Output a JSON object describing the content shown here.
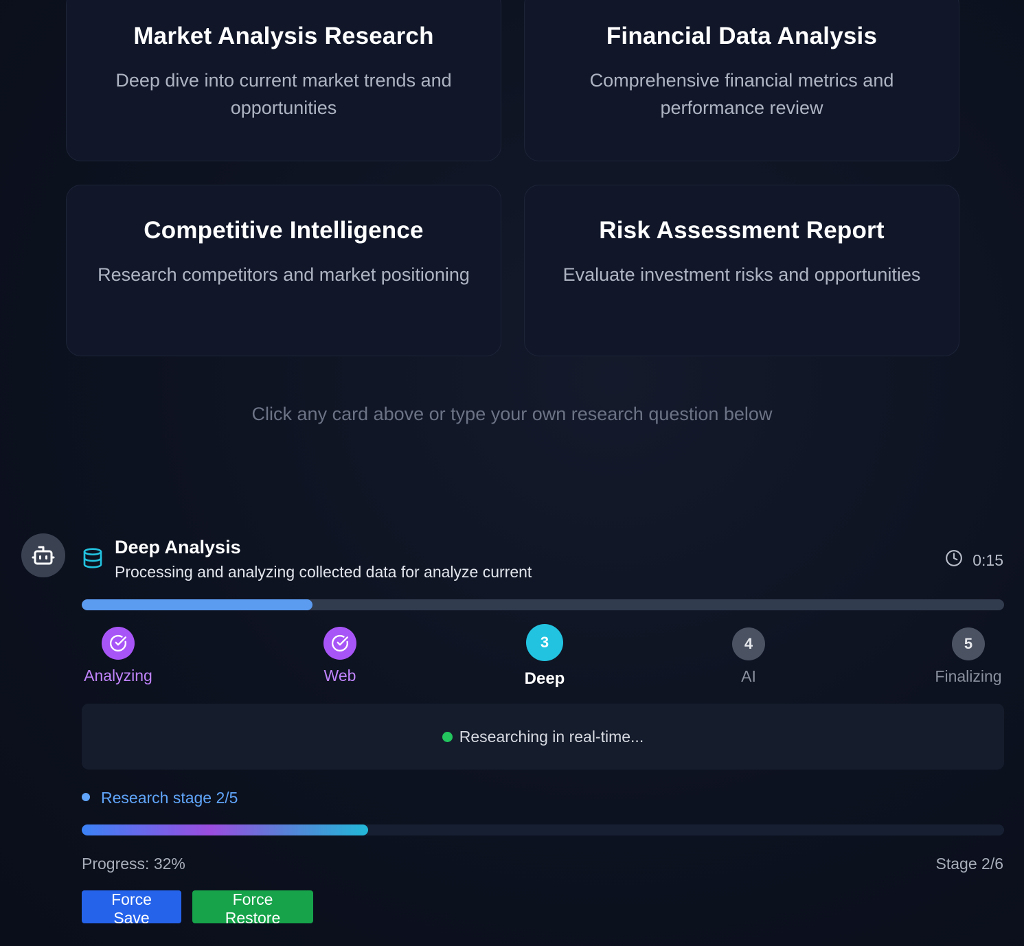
{
  "cards": [
    {
      "title": "Market Analysis Research",
      "desc": "Deep dive into current market trends and opportunities"
    },
    {
      "title": "Financial Data Analysis",
      "desc": "Comprehensive financial metrics and performance review"
    },
    {
      "title": "Competitive Intelligence",
      "desc": "Research competitors and market positioning"
    },
    {
      "title": "Risk Assessment Report",
      "desc": "Evaluate investment risks and opportunities"
    }
  ],
  "hint": "Click any card above or type your own research question below",
  "stage": {
    "title": "Deep Analysis",
    "subtitle": "Processing and analyzing collected data for analyze current",
    "timer": "0:15",
    "top_progress_fraction": 0.25
  },
  "steps": [
    {
      "number": "1",
      "label": "Analyzing",
      "state": "done"
    },
    {
      "number": "2",
      "label": "Web",
      "state": "done"
    },
    {
      "number": "3",
      "label": "Deep",
      "state": "active"
    },
    {
      "number": "4",
      "label": "AI",
      "state": "pending"
    },
    {
      "number": "5",
      "label": "Finalizing",
      "state": "pending"
    }
  ],
  "status": "Researching in real-time...",
  "research_stage": "Research stage 2/5",
  "progress": {
    "label": "Progress: 32%",
    "percent": 32,
    "stage_label": "Stage 2/6"
  },
  "buttons": {
    "save": "Force Save",
    "restore": "Force Restore"
  },
  "icons": {
    "avatar": "robot-icon",
    "stage": "database-icon",
    "timer": "clock-icon",
    "step_done": "check-circle-icon"
  },
  "colors": {
    "done": "#a855f7",
    "active": "#22c3e0",
    "pending": "#4b5363",
    "status_dot": "#22c55e",
    "save_button": "#2563eb",
    "restore_button": "#16a34a"
  }
}
